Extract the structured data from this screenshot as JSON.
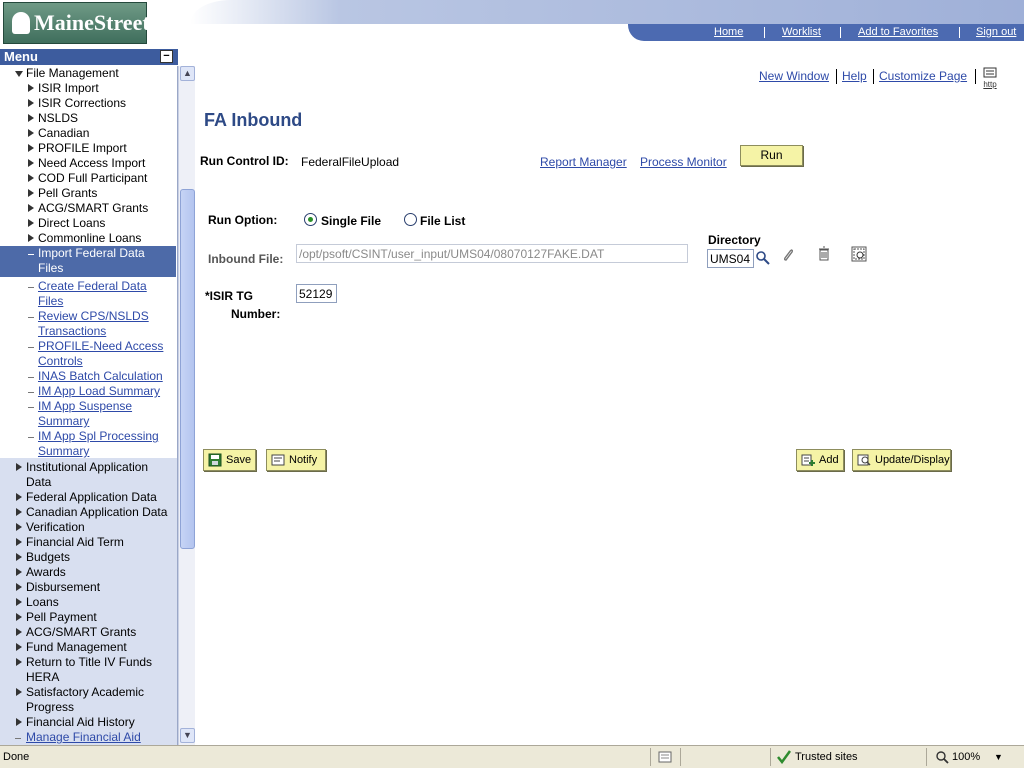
{
  "header": {
    "logo_text": "MaineStreet",
    "nav": [
      "Home",
      "Worklist",
      "Add to Favorites",
      "Sign out"
    ]
  },
  "menu": {
    "title": "Menu",
    "parent": "File Management",
    "sub_folders": [
      "ISIR Import",
      "ISIR Corrections",
      "NSLDS",
      "Canadian",
      "PROFILE Import",
      "Need Access Import",
      "COD Full Participant",
      "Pell Grants",
      "ACG/SMART Grants",
      "Direct Loans",
      "Commonline Loans"
    ],
    "selected": [
      "Import Federal Data",
      "Files"
    ],
    "links": [
      [
        "Create Federal Data",
        "Files"
      ],
      [
        "Review CPS/NSLDS",
        "Transactions"
      ],
      [
        "PROFILE-Need Access",
        "Controls"
      ],
      [
        "INAS Batch Calculation"
      ],
      [
        "IM App Load Summary"
      ],
      [
        "IM App Suspense",
        "Summary"
      ],
      [
        "IM App Spl Processing",
        "Summary"
      ]
    ],
    "folders": [
      [
        "Institutional Application",
        "Data"
      ],
      [
        "Federal Application Data"
      ],
      [
        "Canadian Application Data"
      ],
      [
        "Verification"
      ],
      [
        "Financial Aid Term"
      ],
      [
        "Budgets"
      ],
      [
        "Awards"
      ],
      [
        "Disbursement"
      ],
      [
        "Loans"
      ],
      [
        "Pell Payment"
      ],
      [
        "ACG/SMART Grants"
      ],
      [
        "Fund Management"
      ],
      [
        "Return to Title IV Funds",
        "HERA"
      ],
      [
        "Satisfactory Academic",
        "Progress"
      ],
      [
        "Financial Aid History"
      ]
    ],
    "last_link": "Manage Financial Aid"
  },
  "toplinks": [
    "New Window",
    "Help",
    "Customize Page"
  ],
  "page": {
    "title": "FA Inbound",
    "run_control_label": "Run Control ID:",
    "run_control_value": "FederalFileUpload",
    "report_manager": "Report Manager",
    "process_monitor": "Process Monitor",
    "run_button": "Run",
    "run_option_label": "Run Option:",
    "option_single": "Single File",
    "option_list": "File List",
    "selected_option": "Single File",
    "inbound_label": "Inbound File:",
    "inbound_value": "/opt/psoft/CSINT/user_input/UMS04/08070127FAKE.DAT",
    "directory_label": "Directory",
    "directory_value": "UMS04",
    "isir_label_1": "*ISIR TG",
    "isir_label_2": "Number:",
    "isir_value": "52129",
    "save": "Save",
    "notify": "Notify",
    "add": "Add",
    "update": "Update/Display"
  },
  "status": {
    "text": "Done",
    "zone": "Trusted sites",
    "zoom": "100%"
  }
}
